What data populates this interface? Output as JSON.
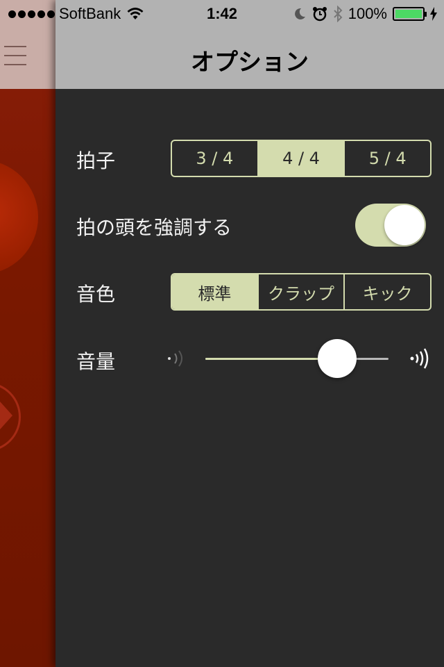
{
  "status_bar": {
    "carrier": "SoftBank",
    "time": "1:42",
    "battery": "100%",
    "battery_level": 1.0
  },
  "nav": {
    "title": "オプション"
  },
  "settings": {
    "time_signature": {
      "label": "拍子",
      "options": [
        "3 / 4",
        "4 / 4",
        "5 / 4"
      ],
      "selected": "4 / 4"
    },
    "accent": {
      "label": "拍の頭を強調する",
      "on": true
    },
    "tone": {
      "label": "音色",
      "options": [
        "標準",
        "クラップ",
        "キック"
      ],
      "selected": "標準"
    },
    "volume": {
      "label": "音量",
      "level": 0.72
    }
  },
  "colors": {
    "accent": "#d4dcae",
    "panel_bg": "#2a2a2a",
    "nav_bg": "#b2b2b2"
  }
}
